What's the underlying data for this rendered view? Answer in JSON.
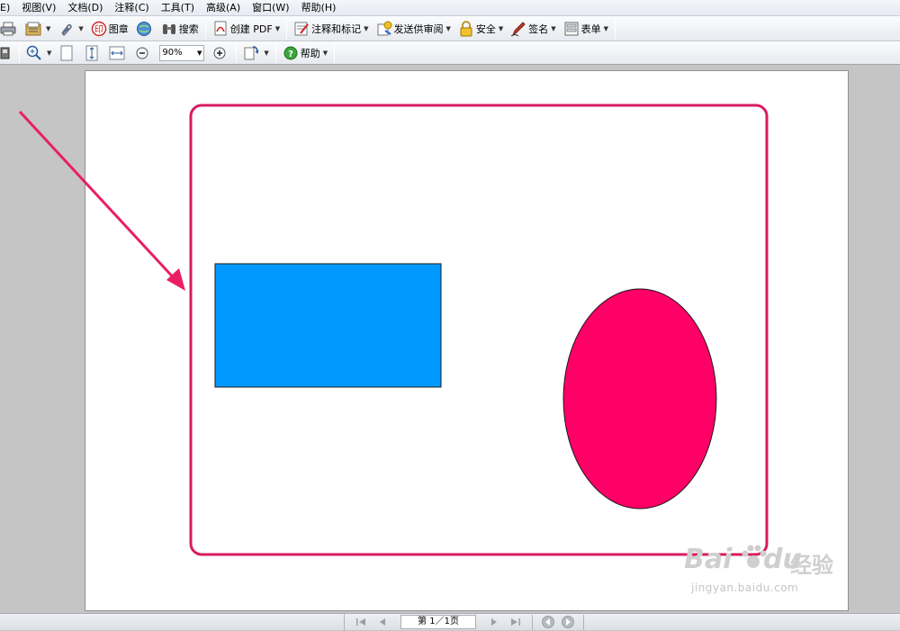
{
  "menubar": {
    "items": [
      "E)",
      "视图(V)",
      "文档(D)",
      "注释(C)",
      "工具(T)",
      "高级(A)",
      "窗口(W)",
      "帮助(H)"
    ]
  },
  "toolbar1": {
    "stamp_label": "图章",
    "search_label": "搜索",
    "create_pdf_label": "创建 PDF",
    "comment_markup_label": "注释和标记",
    "send_review_label": "发送供审阅",
    "security_label": "安全",
    "sign_label": "签名",
    "forms_label": "表单"
  },
  "toolbar2": {
    "zoom_value": "90%",
    "help_label": "帮助"
  },
  "document": {
    "rectangle_color": "#0099ff",
    "ellipse_color": "#ff0066",
    "frame_color": "#d81b60",
    "arrow_color": "#e91e63"
  },
  "statusbar": {
    "page_indicator": "第 1／1页"
  },
  "watermark": {
    "main": "Bai",
    "cn": "经验",
    "url": "jingyan.baidu.com"
  }
}
